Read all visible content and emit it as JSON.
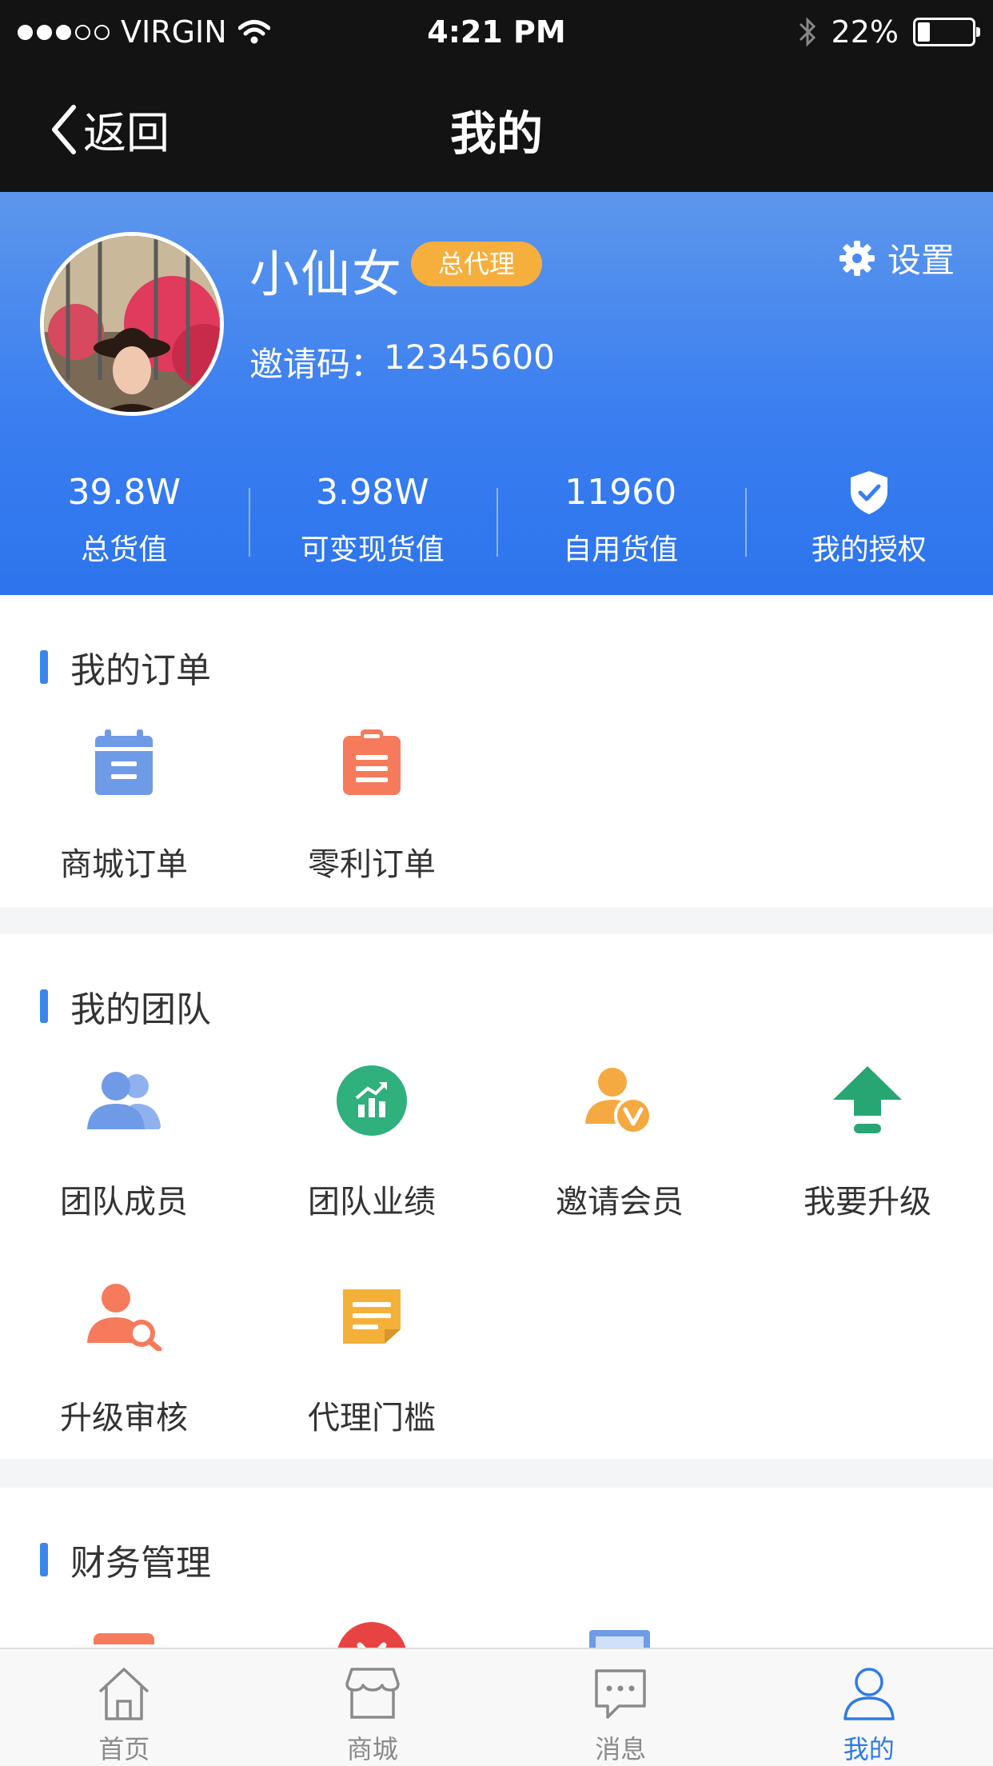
{
  "status_bar": {
    "carrier": "VIRGIN",
    "time": "4:21 PM",
    "battery": "22%",
    "battery_level": 0.22
  },
  "nav": {
    "back_label": "返回",
    "title": "我的"
  },
  "profile": {
    "name": "小仙女",
    "badge": "总代理",
    "invite_label": "邀请码：",
    "invite_code": "12345600",
    "settings_label": "设置"
  },
  "stats": [
    {
      "value": "39.8W",
      "label": "总货值"
    },
    {
      "value": "3.98W",
      "label": "可变现货值"
    },
    {
      "value": "11960",
      "label": "自用货值"
    },
    {
      "icon": "shield-check-icon",
      "label": "我的授权"
    }
  ],
  "orders": {
    "title": "我的订单",
    "items": [
      {
        "label": "商城订单",
        "icon": "calendar-icon",
        "color": "#6f9be6"
      },
      {
        "label": "零利订单",
        "icon": "clipboard-icon",
        "color": "#f57b5c"
      }
    ]
  },
  "team": {
    "title": "我的团队",
    "items": [
      {
        "label": "团队成员",
        "icon": "users-icon",
        "color": "#6f9be6"
      },
      {
        "label": "团队业绩",
        "icon": "chart-icon",
        "color": "#2fb07c"
      },
      {
        "label": "邀请会员",
        "icon": "invite-vip-icon",
        "color": "#f4a941"
      },
      {
        "label": "我要升级",
        "icon": "upgrade-arrow-icon",
        "color": "#27a673"
      },
      {
        "label": "升级审核",
        "icon": "user-search-icon",
        "color": "#f57b5c"
      },
      {
        "label": "代理门槛",
        "icon": "note-icon",
        "color": "#f4b13a"
      }
    ]
  },
  "finance": {
    "title": "财务管理",
    "items": [
      {
        "icon": "card-icon",
        "color": "#f57b5c"
      },
      {
        "icon": "cancel-icon",
        "color": "#e84343"
      },
      {
        "icon": "image-icon",
        "color": "#6f9be6"
      }
    ]
  },
  "tabbar": [
    {
      "label": "首页",
      "icon": "home-icon"
    },
    {
      "label": "商城",
      "icon": "store-icon"
    },
    {
      "label": "消息",
      "icon": "message-icon"
    },
    {
      "label": "我的",
      "icon": "user-icon",
      "active": true
    }
  ]
}
